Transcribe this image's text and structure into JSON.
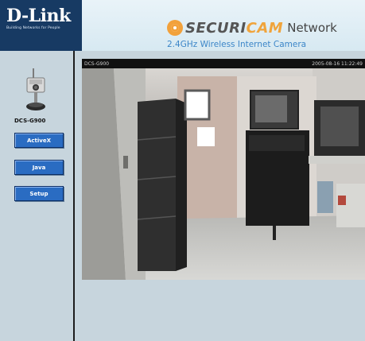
{
  "header": {
    "logo_text": "D-Link",
    "logo_tagline": "Building Networks for People",
    "brand_prefix": "SECURI",
    "brand_highlight": "CAM",
    "brand_suffix": "Network",
    "subtitle": "2.4GHz Wireless Internet Camera"
  },
  "sidebar": {
    "model_label": "DCS-G900",
    "buttons": [
      {
        "label": "ActiveX"
      },
      {
        "label": "Java"
      },
      {
        "label": "Setup"
      }
    ]
  },
  "video": {
    "camera_name": "DCS-G900",
    "timestamp": "2005-08-16 11:22:49"
  },
  "colors": {
    "header_dark": "#173a63",
    "header_light": "#e2f0f6",
    "sidebar_bg": "#c7d5dd",
    "button_blue": "#2a6cc2",
    "subtitle_blue": "#3c86c8",
    "brand_orange": "#f0a43c"
  }
}
